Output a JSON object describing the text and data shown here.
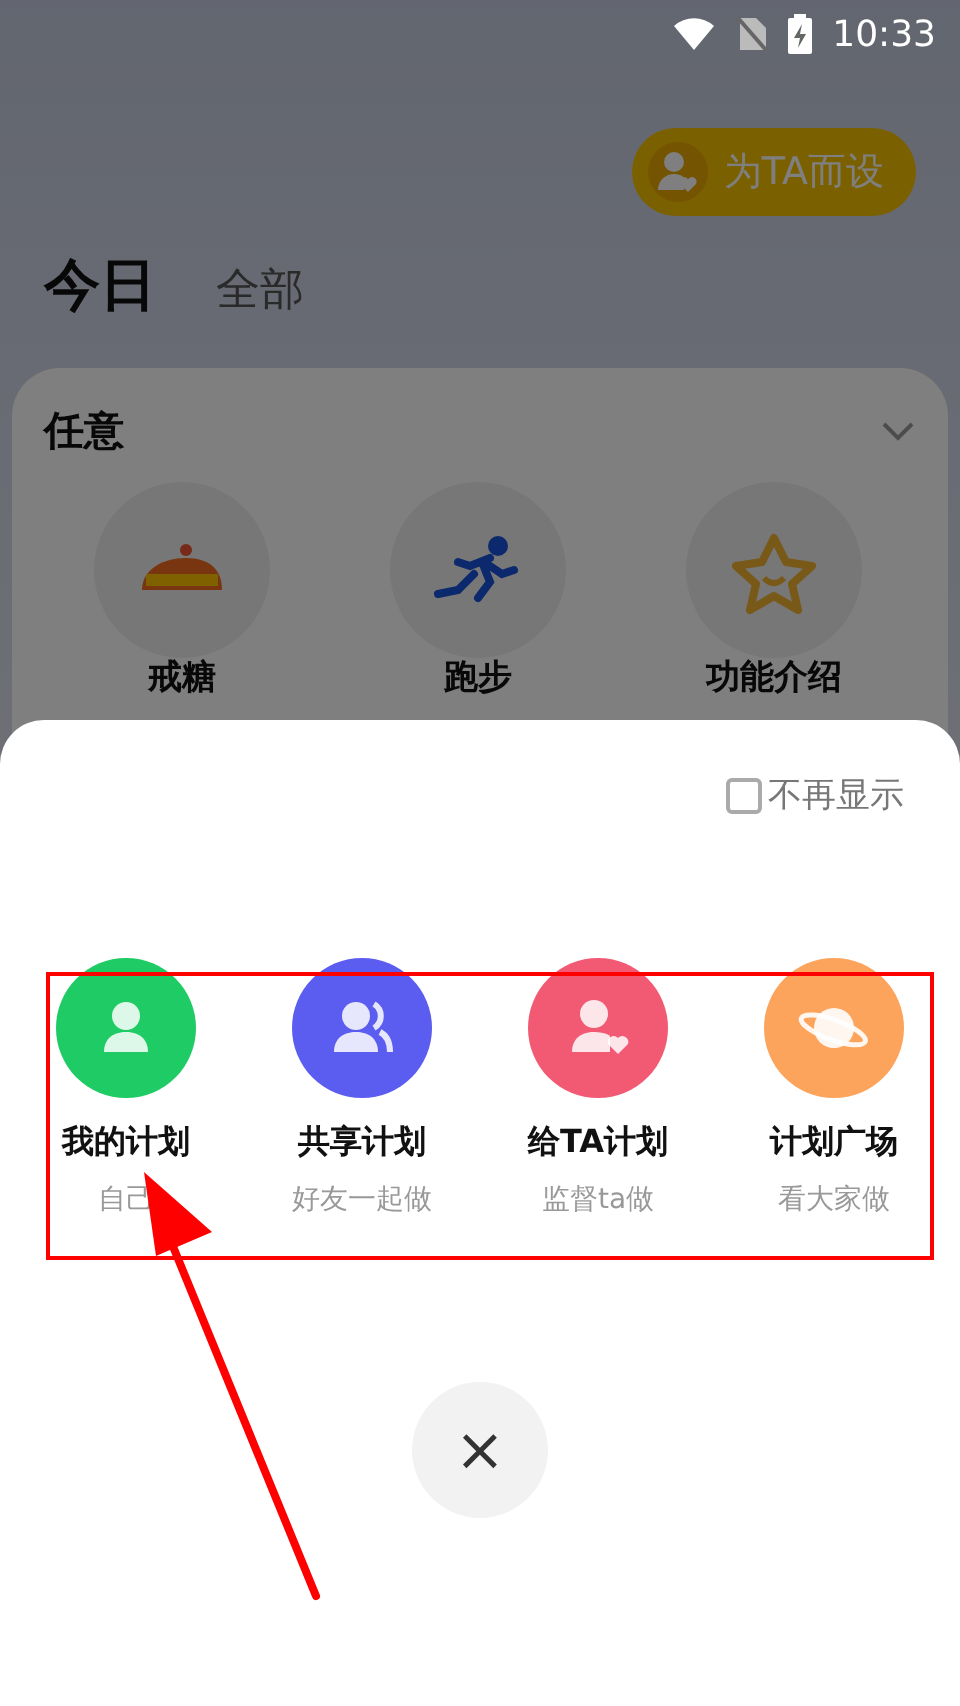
{
  "status_bar": {
    "time": "10:33"
  },
  "header": {
    "badge_button": "为TA而设",
    "tabs": [
      {
        "label": "今日",
        "selected": true
      },
      {
        "label": "全部",
        "selected": false
      }
    ]
  },
  "section": {
    "title": "任意",
    "items": [
      {
        "label": "戒糖",
        "kind": "cake"
      },
      {
        "label": "跑步",
        "kind": "runner"
      },
      {
        "label": "功能介绍",
        "kind": "star"
      }
    ]
  },
  "sheet": {
    "dont_show_again": {
      "label": "不再显示",
      "checked": false
    },
    "options": [
      {
        "title": "我的计划",
        "subtitle": "自己",
        "color": "#1ecb64",
        "kind": "person"
      },
      {
        "title": "共享计划",
        "subtitle": "好友一起做",
        "color": "#5b5cf0",
        "kind": "people"
      },
      {
        "title": "给TA计划",
        "subtitle": "监督ta做",
        "color": "#f25a73",
        "kind": "person-heart"
      },
      {
        "title": "计划广场",
        "subtitle": "看大家做",
        "color": "#fca45c",
        "kind": "planet"
      }
    ],
    "close": "×"
  }
}
